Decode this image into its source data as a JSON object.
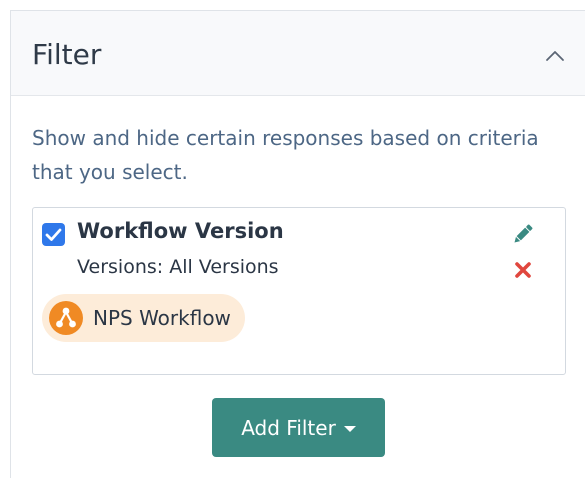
{
  "panel": {
    "title": "Filter",
    "collapse_icon": "chevron-up-icon",
    "description": "Show and hide certain responses based on criteria that you select."
  },
  "filter": {
    "checked": true,
    "name": "Workflow Version",
    "value": "Versions: All Versions",
    "edit_icon": "pencil-icon",
    "delete_icon": "close-icon",
    "chip": {
      "icon": "workflow-icon",
      "label": "NPS Workflow"
    }
  },
  "add_filter": {
    "label": "Add Filter",
    "icon": "caret-down-icon"
  },
  "colors": {
    "primary_button": "#3a8a82",
    "checkbox": "#2f78ea",
    "edit": "#3a8a82",
    "delete": "#e0473e",
    "chip_bg": "#fdecd9",
    "chip_icon": "#f08a24",
    "description_text": "#4d6785"
  }
}
